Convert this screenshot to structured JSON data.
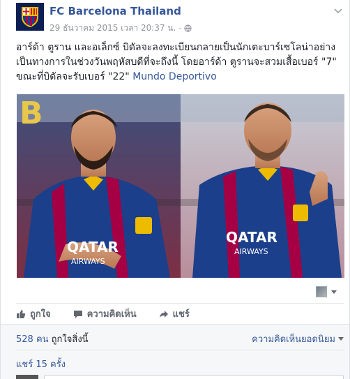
{
  "post": {
    "page_name": "FC Barcelona Thailand",
    "timestamp": "29 ธันวาคม 2015 เวลา 20:37 น.",
    "separator": "·",
    "text_main": "อาร์ด้า ตูราน และอเล็กซ์ บิดัลจะลงทะเบียนกลายเป็นนักเตะบาร์เซโลน่าอย่างเป็นทางการในช่วงวันพฤหัสบดีที่จะถึงนี้ โดยอาร์ด้า ตูรานจะสวมเสื้อเบอร์ \"7\" ขณะที่บิดัลจะรับเบอร์ \"22\"",
    "text_source": "Mundo Deportivo",
    "photo_sponsor": "QATAR",
    "photo_sponsor_sub": "AIRWAYS"
  },
  "actions": {
    "like": "ถูกใจ",
    "comment": "ความคิดเห็น",
    "share": "แชร์"
  },
  "ufi": {
    "likes_count": "528 คน",
    "likes_label": "ถูกใจสิ่งนี้",
    "sort_label": "ความคิดเห็นยอดนิยม",
    "shares_label": "แชร์ 15 ครั้ง"
  },
  "colors": {
    "link": "#365899",
    "barca_blue": "#1b3f8b",
    "barca_red": "#a50044",
    "gold": "#edbb00"
  }
}
